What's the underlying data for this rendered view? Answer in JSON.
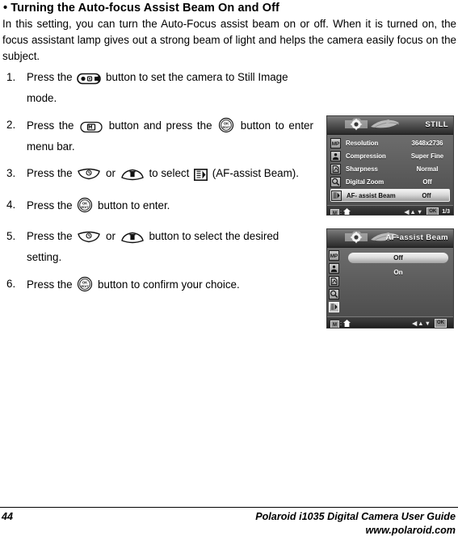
{
  "document": {
    "heading": "• Turning the Auto-focus Assist Beam On and Off",
    "intro": "In this setting, you can turn the Auto-Focus assist beam on or off. When it is turned on, the focus assistant lamp gives out a strong beam of light and helps the camera easily focus on the subject.",
    "steps": [
      {
        "num": "1.",
        "pre": "Press the",
        "icon": "mode-selector-button-icon",
        "post": "button to set the camera to Still Image mode."
      },
      {
        "num": "2.",
        "pre": "Press the",
        "icon": "menu-button-icon",
        "mid": "button and press the",
        "icon2": "ok-edit-button-icon",
        "post": "button to enter menu bar."
      },
      {
        "num": "3.",
        "pre": "Press the",
        "icon": "self-timer-up-button-icon",
        "mid": "or",
        "icon2": "delete-down-button-icon",
        "mid2": "to select",
        "icon3": "af-assist-beam-icon",
        "post": "(AF-assist Beam)."
      },
      {
        "num": "4.",
        "pre": "Press the",
        "icon": "ok-edit-button-icon",
        "post": "button to enter."
      },
      {
        "num": "5.",
        "pre": "Press the",
        "icon": "self-timer-up-button-icon",
        "mid": "or",
        "icon2": "delete-down-button-icon",
        "post": "button to select the desired setting."
      },
      {
        "num": "6.",
        "pre": "Press the",
        "icon": "ok-edit-button-icon",
        "post": "button to confirm your choice."
      }
    ]
  },
  "lcd_menu": {
    "title": "STILL",
    "tab_icons": [
      "camera-settings-tab-icon",
      "tools-tab-icon"
    ],
    "rows": [
      {
        "icon": "resolution-mp-icon",
        "label": "Resolution",
        "value": "3648x2736",
        "selected": false
      },
      {
        "icon": "compression-icon",
        "label": "Compression",
        "value": "Super Fine",
        "selected": false
      },
      {
        "icon": "sharpness-icon",
        "label": "Sharpness",
        "value": "Normal",
        "selected": false
      },
      {
        "icon": "digital-zoom-icon",
        "label": "Digital Zoom",
        "value": "Off",
        "selected": false
      },
      {
        "icon": "af-assist-beam-icon",
        "label": "AF- assist Beam",
        "value": "Off",
        "selected": true
      }
    ],
    "footer": {
      "mode_box": "M",
      "colon": ":",
      "home_icon": "home-icon",
      "arrows": "◀▲▼",
      "ok": "OK",
      "page_count": "1/3"
    }
  },
  "lcd_select": {
    "title": "AF-assist Beam",
    "tab_icons": [
      "camera-settings-tab-icon",
      "tools-tab-icon"
    ],
    "sidebar_icons": [
      {
        "icon": "resolution-mp-icon",
        "active": false
      },
      {
        "icon": "compression-icon",
        "active": false
      },
      {
        "icon": "sharpness-icon",
        "active": false
      },
      {
        "icon": "digital-zoom-icon",
        "active": false
      },
      {
        "icon": "af-assist-beam-icon",
        "active": true
      }
    ],
    "options": [
      {
        "label": "Off",
        "selected": true
      },
      {
        "label": "On",
        "selected": false
      }
    ],
    "footer": {
      "mode_box": "M",
      "colon": ":",
      "home_icon": "home-icon",
      "arrows": "◀▲▼",
      "ok": "OK",
      "page_count": ""
    }
  },
  "footer": {
    "page_number": "44",
    "guide_title": "Polaroid i1035 Digital Camera User Guide",
    "url": "www.polaroid.com"
  }
}
